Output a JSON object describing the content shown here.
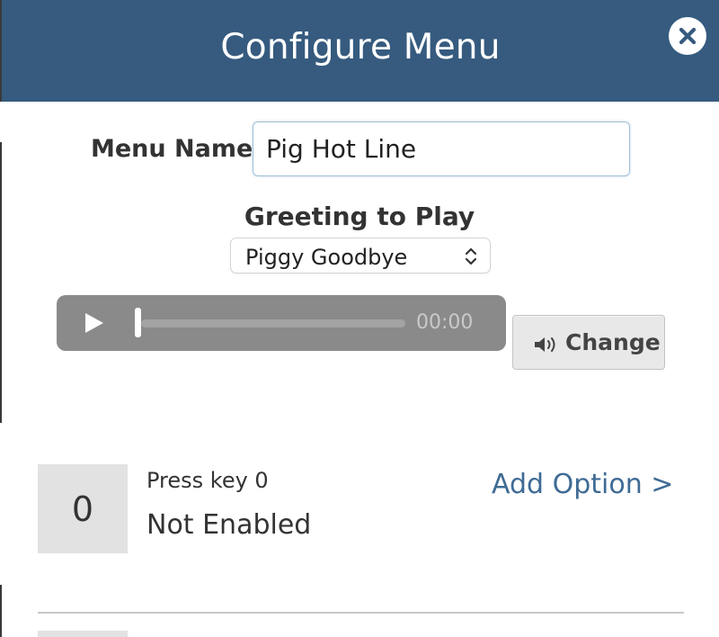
{
  "header": {
    "title": "Configure Menu",
    "close_icon": "close-icon",
    "color": "#365b7f"
  },
  "menu_name": {
    "label": "Menu Name",
    "value": "Pig Hot Line"
  },
  "greeting": {
    "label": "Greeting to Play",
    "selected": "Piggy Goodbye",
    "chevron_icon": "up-down-chevron-icon"
  },
  "audio_player": {
    "play_icon": "play-icon",
    "progress": 0,
    "time": "00:00"
  },
  "change_button": {
    "icon": "speaker-icon",
    "label": "Change"
  },
  "options": [
    {
      "key": "0",
      "press_label": "Press key 0",
      "status": "Not Enabled",
      "action_label": "Add Option >",
      "action_color": "#3f6b95"
    }
  ]
}
